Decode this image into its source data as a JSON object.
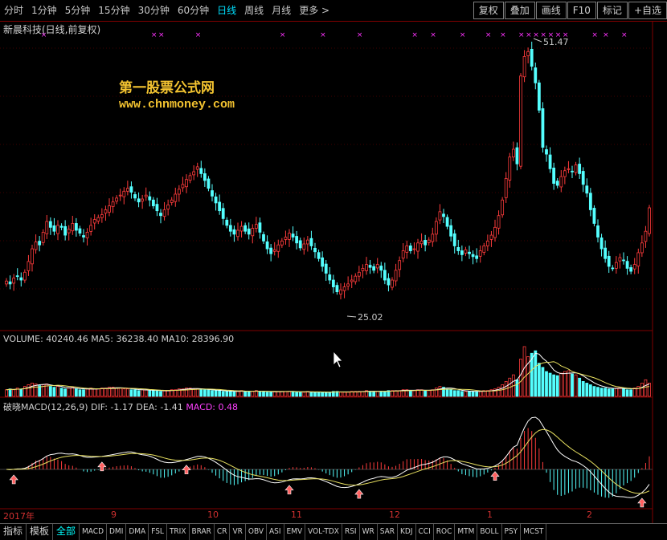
{
  "toolbar": {
    "periods": [
      "分时",
      "1分钟",
      "5分钟",
      "15分钟",
      "30分钟",
      "60分钟",
      "日线",
      "周线",
      "月线",
      "更多 >"
    ],
    "active_period": "日线",
    "right_tools": [
      "复权",
      "叠加",
      "画线",
      "F10",
      "标记",
      "+自选"
    ]
  },
  "stock_title": "新晨科技(日线,前复权)",
  "watermark": {
    "line1": "第一股票公式网",
    "line2": "www.chnmoney.com"
  },
  "price_annotations": {
    "high": "51.47",
    "low": "25.02"
  },
  "volume_legend": "VOLUME: 40240.46  MA5: 36238.40  MA10: 28396.90",
  "macd_legend": {
    "label": "破晓MACD(12,26,9)  DIF: -1.17  DEA: -1.41",
    "macd": "MACD: 0.48"
  },
  "date_axis": [
    "2017年",
    "9",
    "10",
    "11",
    "12",
    "1",
    "2"
  ],
  "bottom_tabs": [
    "指标",
    "模板",
    "全部",
    "MACD",
    "DMI",
    "DMA",
    "FSL",
    "TRIX",
    "BRAR",
    "CR",
    "VR",
    "OBV",
    "ASI",
    "EMV",
    "VOL-TDX",
    "RSI",
    "WR",
    "SAR",
    "KDJ",
    "CCI",
    "ROC",
    "MTM",
    "BOLL",
    "PSY",
    "MCST"
  ],
  "active_bottom_tab": "全部",
  "colors": {
    "up": "#ff3c3c",
    "down": "#54ffff",
    "axis": "#800000",
    "marker": "#ff33ff",
    "watermark": "#f2c230"
  },
  "chart_data": {
    "type": "candlestick",
    "y_range": [
      23,
      53
    ],
    "close_series": [
      27.5,
      27.2,
      27.8,
      28.0,
      27.6,
      28.4,
      29.5,
      30.8,
      31.5,
      31.2,
      32.5,
      33.6,
      33.0,
      32.6,
      33.2,
      33.0,
      32.2,
      32.8,
      33.4,
      32.7,
      32.4,
      32.0,
      32.5,
      33.2,
      33.8,
      34.0,
      34.3,
      34.8,
      35.2,
      35.6,
      36.0,
      36.3,
      36.7,
      37.0,
      36.6,
      36.0,
      35.6,
      35.9,
      36.3,
      35.8,
      35.2,
      34.7,
      34.2,
      34.8,
      35.3,
      35.8,
      36.4,
      36.9,
      37.4,
      37.9,
      38.3,
      38.7,
      39.2,
      38.5,
      37.8,
      37.0,
      36.2,
      35.5,
      34.7,
      33.9,
      33.2,
      32.6,
      32.3,
      32.7,
      33.1,
      32.6,
      32.3,
      32.9,
      33.3,
      32.5,
      31.6,
      30.8,
      30.3,
      30.7,
      31.2,
      31.6,
      32.0,
      32.4,
      32.0,
      31.4,
      30.9,
      31.3,
      31.7,
      31.1,
      30.5,
      29.8,
      29.0,
      28.3,
      27.6,
      26.9,
      26.4,
      26.6,
      26.9,
      27.2,
      27.6,
      28.0,
      28.4,
      28.8,
      29.2,
      28.9,
      28.6,
      29.2,
      28.6,
      27.6,
      27.1,
      27.6,
      28.6,
      29.6,
      30.6,
      31.1,
      30.6,
      30.8,
      31.4,
      31.6,
      31.2,
      31.7,
      32.3,
      33.6,
      34.6,
      34.1,
      33.1,
      32.1,
      31.1,
      30.6,
      30.2,
      30.7,
      30.3,
      30.0,
      29.8,
      30.6,
      31.1,
      31.6,
      32.2,
      33.0,
      34.2,
      35.8,
      38.0,
      40.2,
      41.0,
      39.5,
      48.5,
      50.5,
      51.0,
      49.5,
      47.8,
      45.0,
      41.2,
      40.5,
      39.0,
      37.5,
      37.3,
      38.2,
      38.8,
      39.0,
      38.7,
      39.4,
      38.5,
      37.4,
      36.5,
      34.8,
      33.4,
      32.0,
      30.8,
      29.8,
      29.0,
      28.8,
      29.4,
      29.9,
      29.6,
      28.8,
      28.5,
      29.2,
      30.4,
      31.4,
      32.6,
      35.0
    ],
    "volume_series": [
      8,
      9,
      8,
      10,
      9,
      12,
      14,
      16,
      15,
      13,
      14,
      15,
      12,
      11,
      12,
      10,
      9,
      10,
      11,
      9,
      8,
      8,
      9,
      10,
      9,
      9,
      10,
      10,
      11,
      11,
      10,
      10,
      9,
      9,
      8,
      8,
      7,
      8,
      8,
      7,
      7,
      7,
      6,
      7,
      7,
      8,
      8,
      9,
      9,
      10,
      10,
      9,
      9,
      8,
      8,
      8,
      7,
      7,
      7,
      6,
      6,
      6,
      6,
      6,
      7,
      6,
      6,
      6,
      7,
      6,
      6,
      5,
      5,
      6,
      6,
      6,
      6,
      6,
      6,
      5,
      5,
      5,
      6,
      5,
      5,
      5,
      5,
      5,
      5,
      6,
      6,
      5,
      5,
      5,
      6,
      6,
      6,
      6,
      7,
      6,
      6,
      6,
      6,
      6,
      7,
      7,
      7,
      7,
      8,
      8,
      7,
      7,
      8,
      8,
      7,
      7,
      8,
      10,
      12,
      11,
      9,
      8,
      7,
      7,
      6,
      6,
      6,
      6,
      6,
      6,
      7,
      7,
      8,
      9,
      11,
      14,
      18,
      22,
      26,
      20,
      45,
      60,
      48,
      52,
      55,
      40,
      35,
      30,
      28,
      26,
      25,
      28,
      30,
      31,
      27,
      26,
      22,
      18,
      16,
      14,
      12,
      11,
      10,
      10,
      9,
      9,
      10,
      11,
      9,
      8,
      8,
      10,
      12,
      16,
      20,
      16
    ]
  }
}
